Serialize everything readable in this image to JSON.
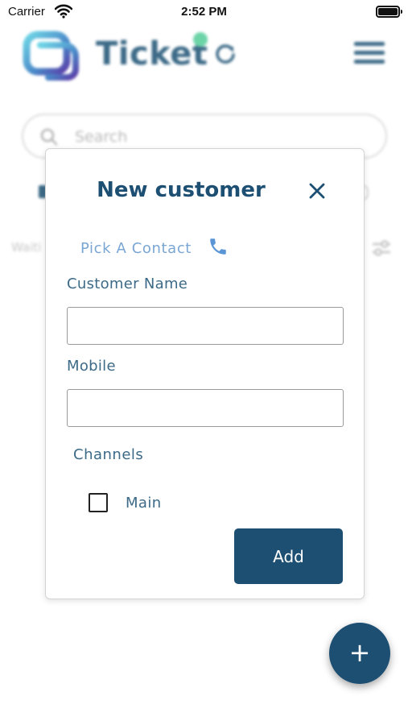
{
  "status_bar": {
    "carrier": "Carrier",
    "time": "2:52 PM"
  },
  "header": {
    "brand": "Ticket",
    "logo_icon": "chat-bubble-logo-icon",
    "refresh_icon": "refresh-icon",
    "menu_icon": "hamburger-menu-icon"
  },
  "search": {
    "placeholder": "Search"
  },
  "background": {
    "status_text": "Waiti"
  },
  "modal": {
    "title": "New customer",
    "pick_contact": "Pick A Contact",
    "customer_name_label": "Customer Name",
    "customer_name_value": "",
    "mobile_label": "Mobile",
    "mobile_value": "",
    "channels_label": "Channels",
    "channels": [
      {
        "label": "Main",
        "checked": false
      }
    ],
    "add_button": "Add"
  },
  "fab": {
    "label": "+"
  },
  "colors": {
    "primary": "#1d4f73",
    "link": "#7aa6d4",
    "accent_dot": "#6dd4a8",
    "text_secondary": "#3c6a87"
  }
}
